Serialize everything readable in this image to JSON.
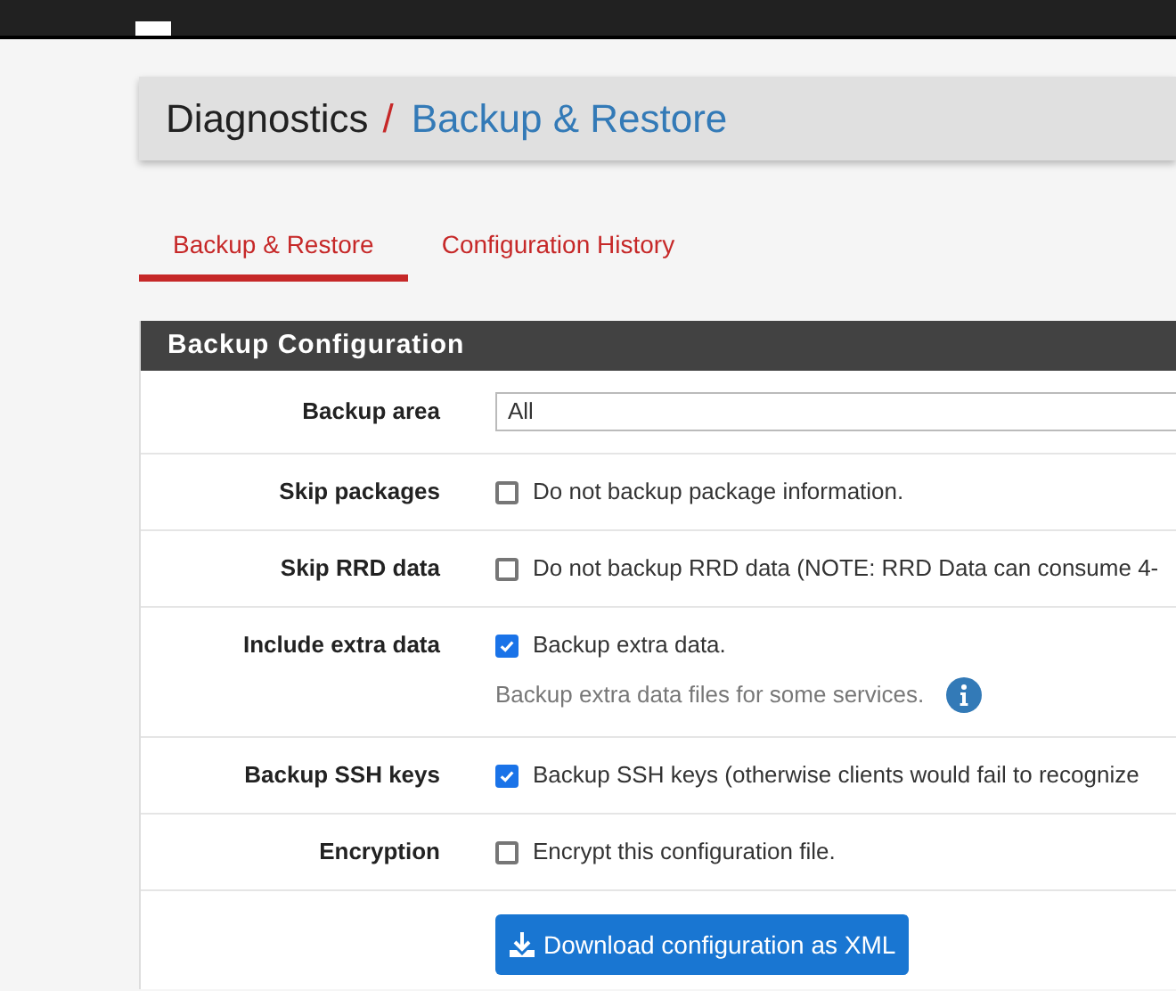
{
  "breadcrumb": {
    "section": "Diagnostics",
    "separator": "/",
    "page": "Backup & Restore"
  },
  "tabs": [
    {
      "label": "Backup & Restore",
      "selected": true
    },
    {
      "label": "Configuration History",
      "selected": false
    }
  ],
  "panel": {
    "title": "Backup Configuration",
    "rows": [
      {
        "kind": "select",
        "label": "Backup area",
        "value": "All"
      },
      {
        "kind": "checkbox",
        "label": "Skip packages",
        "text": "Do not backup package information.",
        "checked": false
      },
      {
        "kind": "checkbox",
        "label": "Skip RRD data",
        "text": "Do not backup RRD data (NOTE: RRD Data can consume 4-",
        "checked": false
      },
      {
        "kind": "checkbox",
        "label": "Include extra data",
        "text": "Backup extra data.",
        "checked": true,
        "help": "Backup extra data files for some services."
      },
      {
        "kind": "checkbox",
        "label": "Backup SSH keys",
        "text": "Backup SSH keys (otherwise clients would fail to recognize",
        "checked": true
      },
      {
        "kind": "checkbox",
        "label": "Encryption",
        "text": "Encrypt this configuration file.",
        "checked": false
      }
    ],
    "button": "Download configuration as XML"
  }
}
